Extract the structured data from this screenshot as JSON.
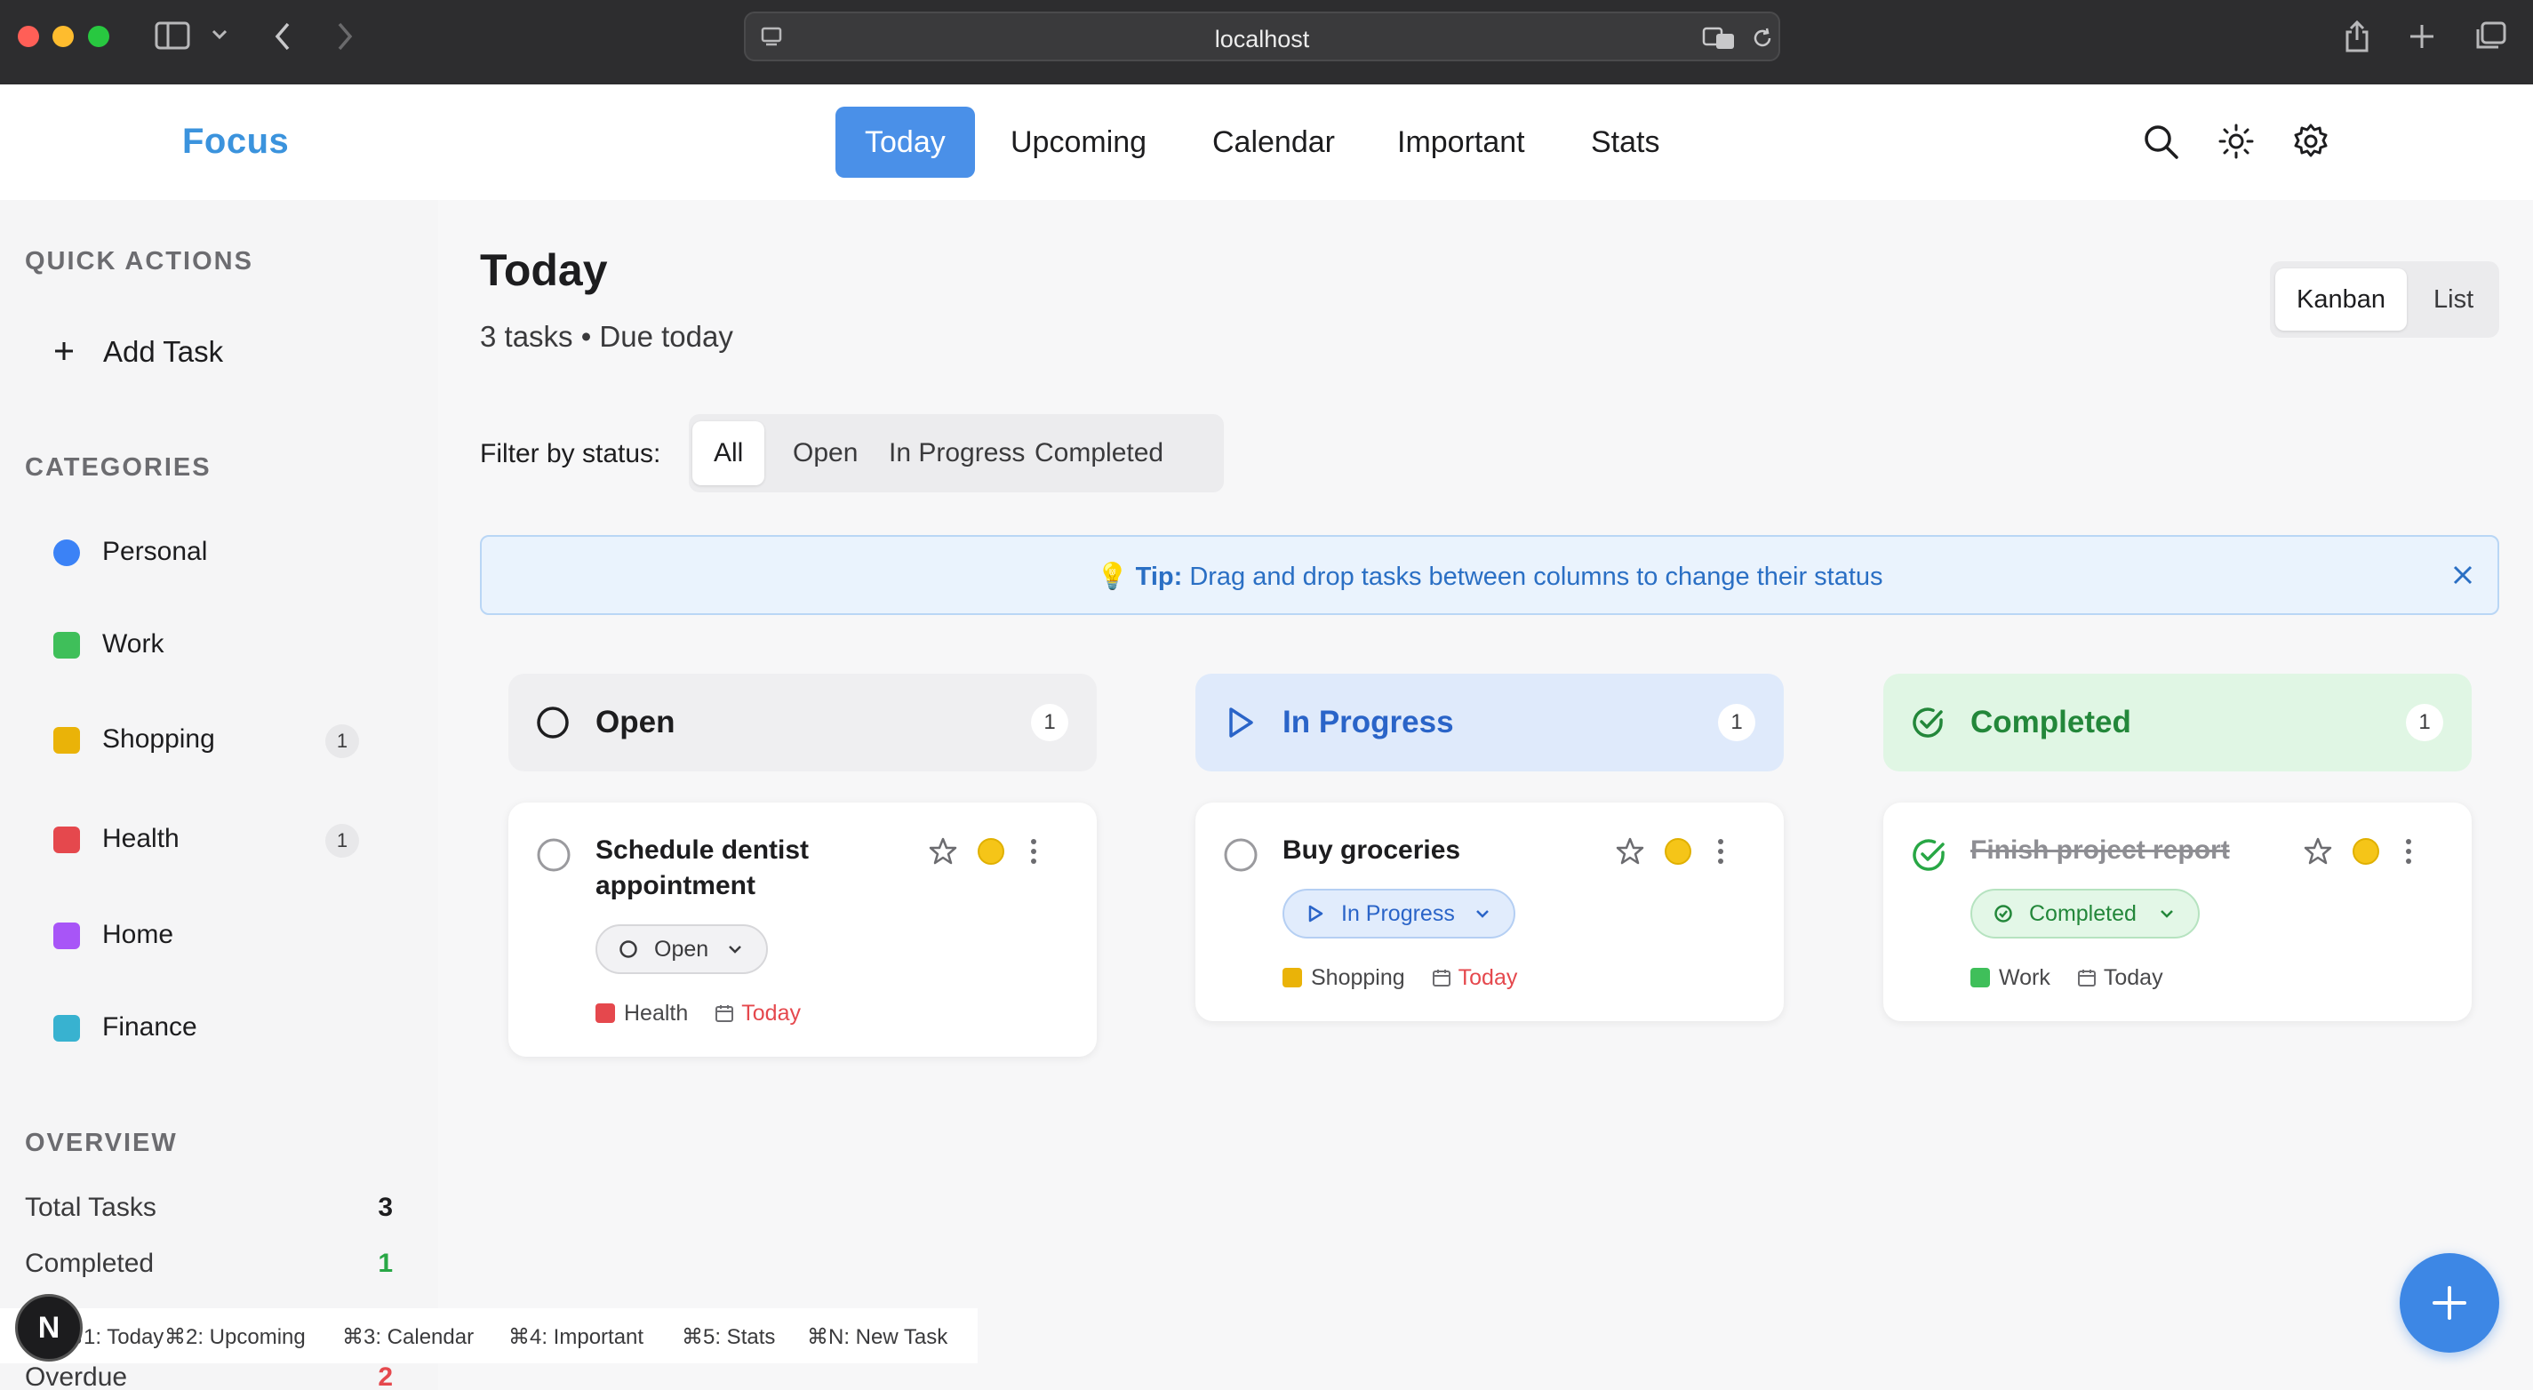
{
  "browser": {
    "url": "localhost"
  },
  "app": {
    "logo": "Focus"
  },
  "nav": {
    "tabs": [
      "Today",
      "Upcoming",
      "Calendar",
      "Important",
      "Stats"
    ],
    "active": "Today"
  },
  "sidebar": {
    "quick_actions_title": "QUICK ACTIONS",
    "add_task": "Add Task",
    "categories_title": "CATEGORIES",
    "categories": [
      {
        "label": "Personal",
        "color": "#3b82f6",
        "count": ""
      },
      {
        "label": "Work",
        "color": "#3fbf5a",
        "count": ""
      },
      {
        "label": "Shopping",
        "color": "#eab308",
        "count": "1"
      },
      {
        "label": "Health",
        "color": "#e5484d",
        "count": "1"
      },
      {
        "label": "Home",
        "color": "#a855f7",
        "count": ""
      },
      {
        "label": "Finance",
        "color": "#38b2d0",
        "count": ""
      }
    ],
    "overview_title": "OVERVIEW",
    "overview": [
      {
        "label": "Total Tasks",
        "value": "3",
        "color": "#1d1d1f"
      },
      {
        "label": "Completed",
        "value": "1",
        "color": "#28a745"
      },
      {
        "label": "Overdue",
        "value": "2",
        "color": "#e5484d"
      }
    ]
  },
  "main": {
    "title": "Today",
    "subtitle": "3 tasks • Due today",
    "view_toggle": [
      "Kanban",
      "List"
    ],
    "filter_label": "Filter by status:",
    "filters": [
      "All",
      "Open",
      "In Progress",
      "Completed"
    ],
    "tip_prefix": "Tip:",
    "tip_text": "Drag and drop tasks between columns to change their status"
  },
  "columns": [
    {
      "title": "Open",
      "count": "1",
      "bg": "#efeff1",
      "fg": "#1d1d1f",
      "card": {
        "title": "Schedule dentist appointment",
        "status": "Open",
        "category": "Health",
        "category_color": "#e5484d",
        "due": "Today",
        "due_color": "#e5484d"
      }
    },
    {
      "title": "In Progress",
      "count": "1",
      "bg": "#dfeafb",
      "fg": "#2a64c8",
      "card": {
        "title": "Buy groceries",
        "status": "In Progress",
        "category": "Shopping",
        "category_color": "#eab308",
        "due": "Today",
        "due_color": "#e5484d"
      }
    },
    {
      "title": "Completed",
      "count": "1",
      "bg": "#e0f6e4",
      "fg": "#23873a",
      "card": {
        "title": "Finish project report",
        "status": "Completed",
        "category": "Work",
        "category_color": "#3fbf5a",
        "due": "Today",
        "due_color": "#48484a"
      }
    }
  ],
  "shortcuts": [
    "⌘1: Today",
    "⌘2: Upcoming",
    "⌘3: Calendar",
    "⌘4: Important",
    "⌘5: Stats",
    "⌘N: New Task"
  ],
  "badge": "N"
}
